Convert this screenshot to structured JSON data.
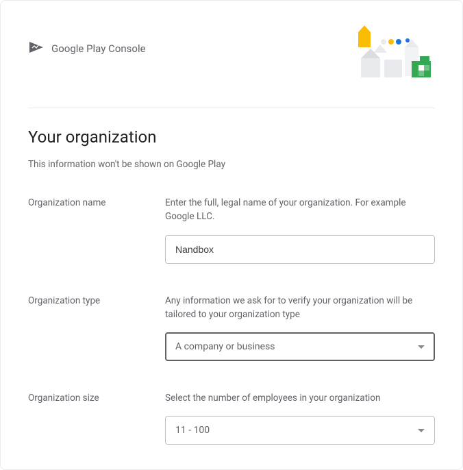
{
  "brand": {
    "label": "Google Play Console"
  },
  "heading": "Your organization",
  "subtitle": "This information won't be shown on Google Play",
  "fields": {
    "orgName": {
      "label": "Organization name",
      "helper": "Enter the full, legal name of your organization. For example Google LLC.",
      "value": "Nandbox"
    },
    "orgType": {
      "label": "Organization type",
      "helper": "Any information we ask for to verify your organization will be tailored to your organization type",
      "value": "A company or business"
    },
    "orgSize": {
      "label": "Organization size",
      "helper": "Select the number of employees in your organization",
      "value": "11 - 100"
    }
  }
}
